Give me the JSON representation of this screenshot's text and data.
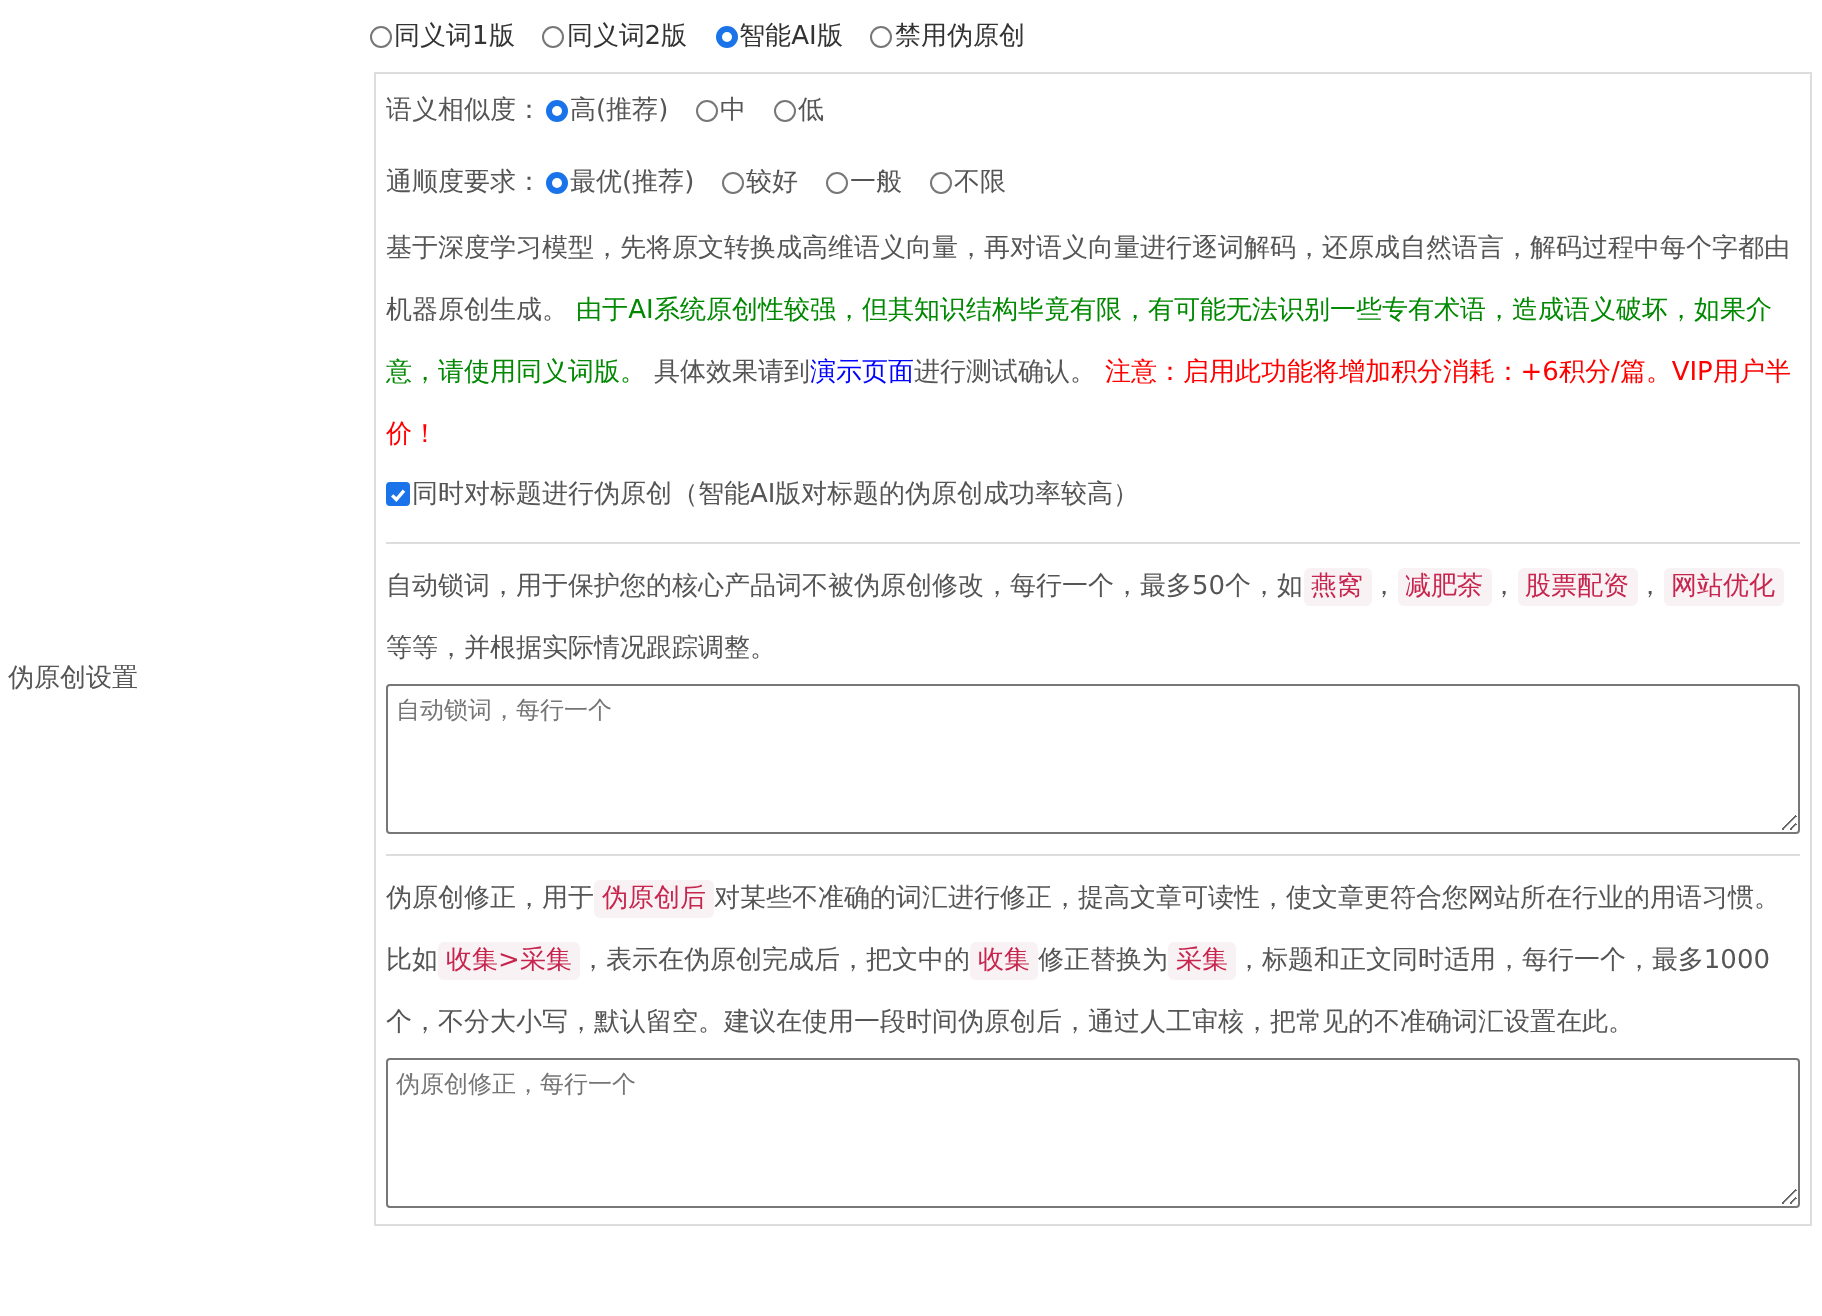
{
  "section_label": "伪原创设置",
  "mode_options": [
    {
      "label": "同义词1版",
      "selected": false
    },
    {
      "label": "同义词2版",
      "selected": false
    },
    {
      "label": "智能AI版",
      "selected": true
    },
    {
      "label": "禁用伪原创",
      "selected": false
    }
  ],
  "similarity": {
    "label": "语义相似度：",
    "options": [
      {
        "label": "高(推荐)",
        "selected": true
      },
      {
        "label": "中",
        "selected": false
      },
      {
        "label": "低",
        "selected": false
      }
    ]
  },
  "fluency": {
    "label": "通顺度要求：",
    "options": [
      {
        "label": "最优(推荐)",
        "selected": true
      },
      {
        "label": "较好",
        "selected": false
      },
      {
        "label": "一般",
        "selected": false
      },
      {
        "label": "不限",
        "selected": false
      }
    ]
  },
  "ai_description": [
    {
      "kind": "text",
      "text": "基于深度学习模型，先将原文转换成高维语义向量，再对语义向量进行逐词解码，还原成自然语言，解码过程中每个字都由机器原创生成。 "
    },
    {
      "kind": "green",
      "text": "由于AI系统原创性较强，但其知识结构毕竟有限，有可能无法识别一些专有术语，造成语义破坏，如果介意，请使用同义词版。"
    },
    {
      "kind": "text",
      "text": " 具体效果请到"
    },
    {
      "kind": "link",
      "text": "演示页面"
    },
    {
      "kind": "text",
      "text": "进行测试确认。 "
    },
    {
      "kind": "red",
      "text": "注意：启用此功能将增加积分消耗：+6积分/篇。VIP用户半价！"
    }
  ],
  "title_checkbox": {
    "label": "同时对标题进行伪原创（智能AI版对标题的伪原创成功率较高）",
    "checked": true
  },
  "lock_words": {
    "description": [
      {
        "kind": "text",
        "text": "自动锁词，用于保护您的核心产品词不被伪原创修改，每行一个，最多50个，如"
      },
      {
        "kind": "code",
        "text": "燕窝"
      },
      {
        "kind": "text",
        "text": "，"
      },
      {
        "kind": "code",
        "text": "减肥茶"
      },
      {
        "kind": "text",
        "text": "，"
      },
      {
        "kind": "code",
        "text": "股票配资"
      },
      {
        "kind": "text",
        "text": "，"
      },
      {
        "kind": "code",
        "text": "网站优化"
      },
      {
        "kind": "text",
        "text": " 等等，并根据实际情况跟踪调整。"
      }
    ],
    "placeholder": "自动锁词，每行一个"
  },
  "correction": {
    "description": [
      {
        "kind": "text",
        "text": "伪原创修正，用于"
      },
      {
        "kind": "code",
        "text": "伪原创后"
      },
      {
        "kind": "text",
        "text": "对某些不准确的词汇进行修正，提高文章可读性，使文章更符合您网站所在行业的用语习惯。比如"
      },
      {
        "kind": "code",
        "text": "收集>采集"
      },
      {
        "kind": "text",
        "text": "，表示在伪原创完成后，把文中的"
      },
      {
        "kind": "code",
        "text": "收集"
      },
      {
        "kind": "text",
        "text": "修正替换为"
      },
      {
        "kind": "code",
        "text": "采集"
      },
      {
        "kind": "text",
        "text": "，标题和正文同时适用，每行一个，最多1000个，不分大小写，默认留空。建议在使用一段时间伪原创后，通过人工审核，把常见的不准确词汇设置在此。"
      }
    ],
    "placeholder": "伪原创修正，每行一个"
  }
}
